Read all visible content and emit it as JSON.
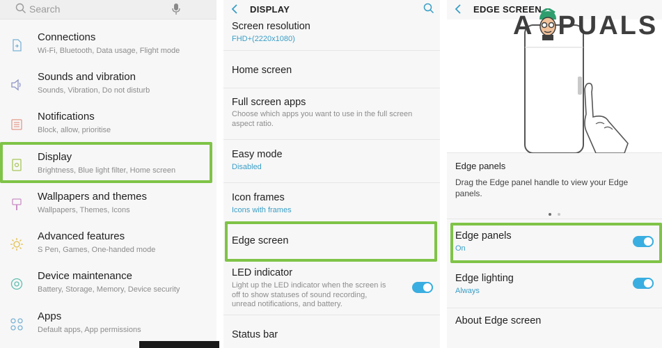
{
  "colors": {
    "highlight": "#7fc347",
    "toggle": "#3aaee0",
    "accent_text": "#3a9ec6"
  },
  "settings": {
    "search_placeholder": "Search",
    "items": [
      {
        "icon": "connections-icon",
        "title": "Connections",
        "sub": "Wi-Fi, Bluetooth, Data usage, Flight mode"
      },
      {
        "icon": "sound-icon",
        "title": "Sounds and vibration",
        "sub": "Sounds, Vibration, Do not disturb"
      },
      {
        "icon": "notifications-icon",
        "title": "Notifications",
        "sub": "Block, allow, prioritise"
      },
      {
        "icon": "display-icon",
        "title": "Display",
        "sub": "Brightness, Blue light filter, Home screen"
      },
      {
        "icon": "wallpaper-icon",
        "title": "Wallpapers and themes",
        "sub": "Wallpapers, Themes, Icons"
      },
      {
        "icon": "advanced-features-icon",
        "title": "Advanced features",
        "sub": "S Pen, Games, One-handed mode"
      },
      {
        "icon": "device-maintenance-icon",
        "title": "Device maintenance",
        "sub": "Battery, Storage, Memory, Device security"
      },
      {
        "icon": "apps-icon",
        "title": "Apps",
        "sub": "Default apps, App permissions"
      }
    ]
  },
  "display": {
    "header": "DISPLAY",
    "screen_resolution": {
      "title": "Screen resolution",
      "value": "FHD+(2220x1080)"
    },
    "home_screen": {
      "title": "Home screen"
    },
    "full_screen_apps": {
      "title": "Full screen apps",
      "sub": "Choose which apps you want to use in the full screen aspect ratio."
    },
    "easy_mode": {
      "title": "Easy mode",
      "value": "Disabled"
    },
    "icon_frames": {
      "title": "Icon frames",
      "value": "Icons with frames"
    },
    "edge_screen": {
      "title": "Edge screen"
    },
    "led_indicator": {
      "title": "LED indicator",
      "sub": "Light up the LED indicator when the screen is off to show statuses of sound recording, unread notifications, and battery.",
      "enabled": true
    },
    "status_bar": {
      "title": "Status bar"
    }
  },
  "edge": {
    "header": "EDGE SCREEN",
    "logo_text_left": "A",
    "logo_text_right": "PUALS",
    "section_label": "Edge panels",
    "section_desc": "Drag the Edge panel handle to view your Edge panels.",
    "edge_panels": {
      "title": "Edge panels",
      "value": "On",
      "enabled": true
    },
    "edge_lighting": {
      "title": "Edge lighting",
      "value": "Always",
      "enabled": true
    },
    "about": {
      "title": "About Edge screen"
    }
  }
}
